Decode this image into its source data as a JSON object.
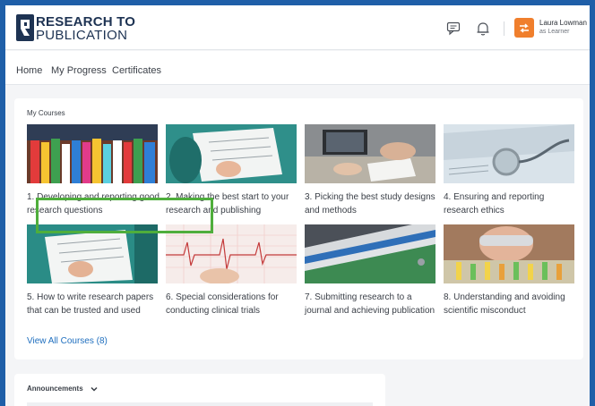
{
  "brand": {
    "line1": "RESEARCH TO",
    "line2": "PUBLICATION"
  },
  "header": {
    "user_name": "Laura Lowman",
    "user_role": "as Learner",
    "icons": [
      "message-icon",
      "bell-icon",
      "switch-arrows-icon"
    ]
  },
  "nav": {
    "items": [
      "Home",
      "My Progress",
      "Certificates"
    ]
  },
  "courses": {
    "title": "My Courses",
    "view_all": "View All Courses (8)",
    "items": [
      {
        "title": "1. Developing and reporting good research questions"
      },
      {
        "title": "2. Making the best start to your research and publishing"
      },
      {
        "title": "3. Picking the best study designs and methods"
      },
      {
        "title": "4. Ensuring and reporting research ethics"
      },
      {
        "title": "5. How to write research papers that can be trusted and used"
      },
      {
        "title": "6. Special considerations for conducting clinical trials"
      },
      {
        "title": "7. Submitting research to a journal and achieving publication"
      },
      {
        "title": "8. Understanding and avoiding scientific misconduct"
      }
    ]
  },
  "announcements": {
    "title": "Announcements"
  },
  "colors": {
    "frame": "#1f5fa8",
    "accent": "#f07f2d",
    "highlight": "#4fae3c",
    "link": "#1f6fbf"
  }
}
